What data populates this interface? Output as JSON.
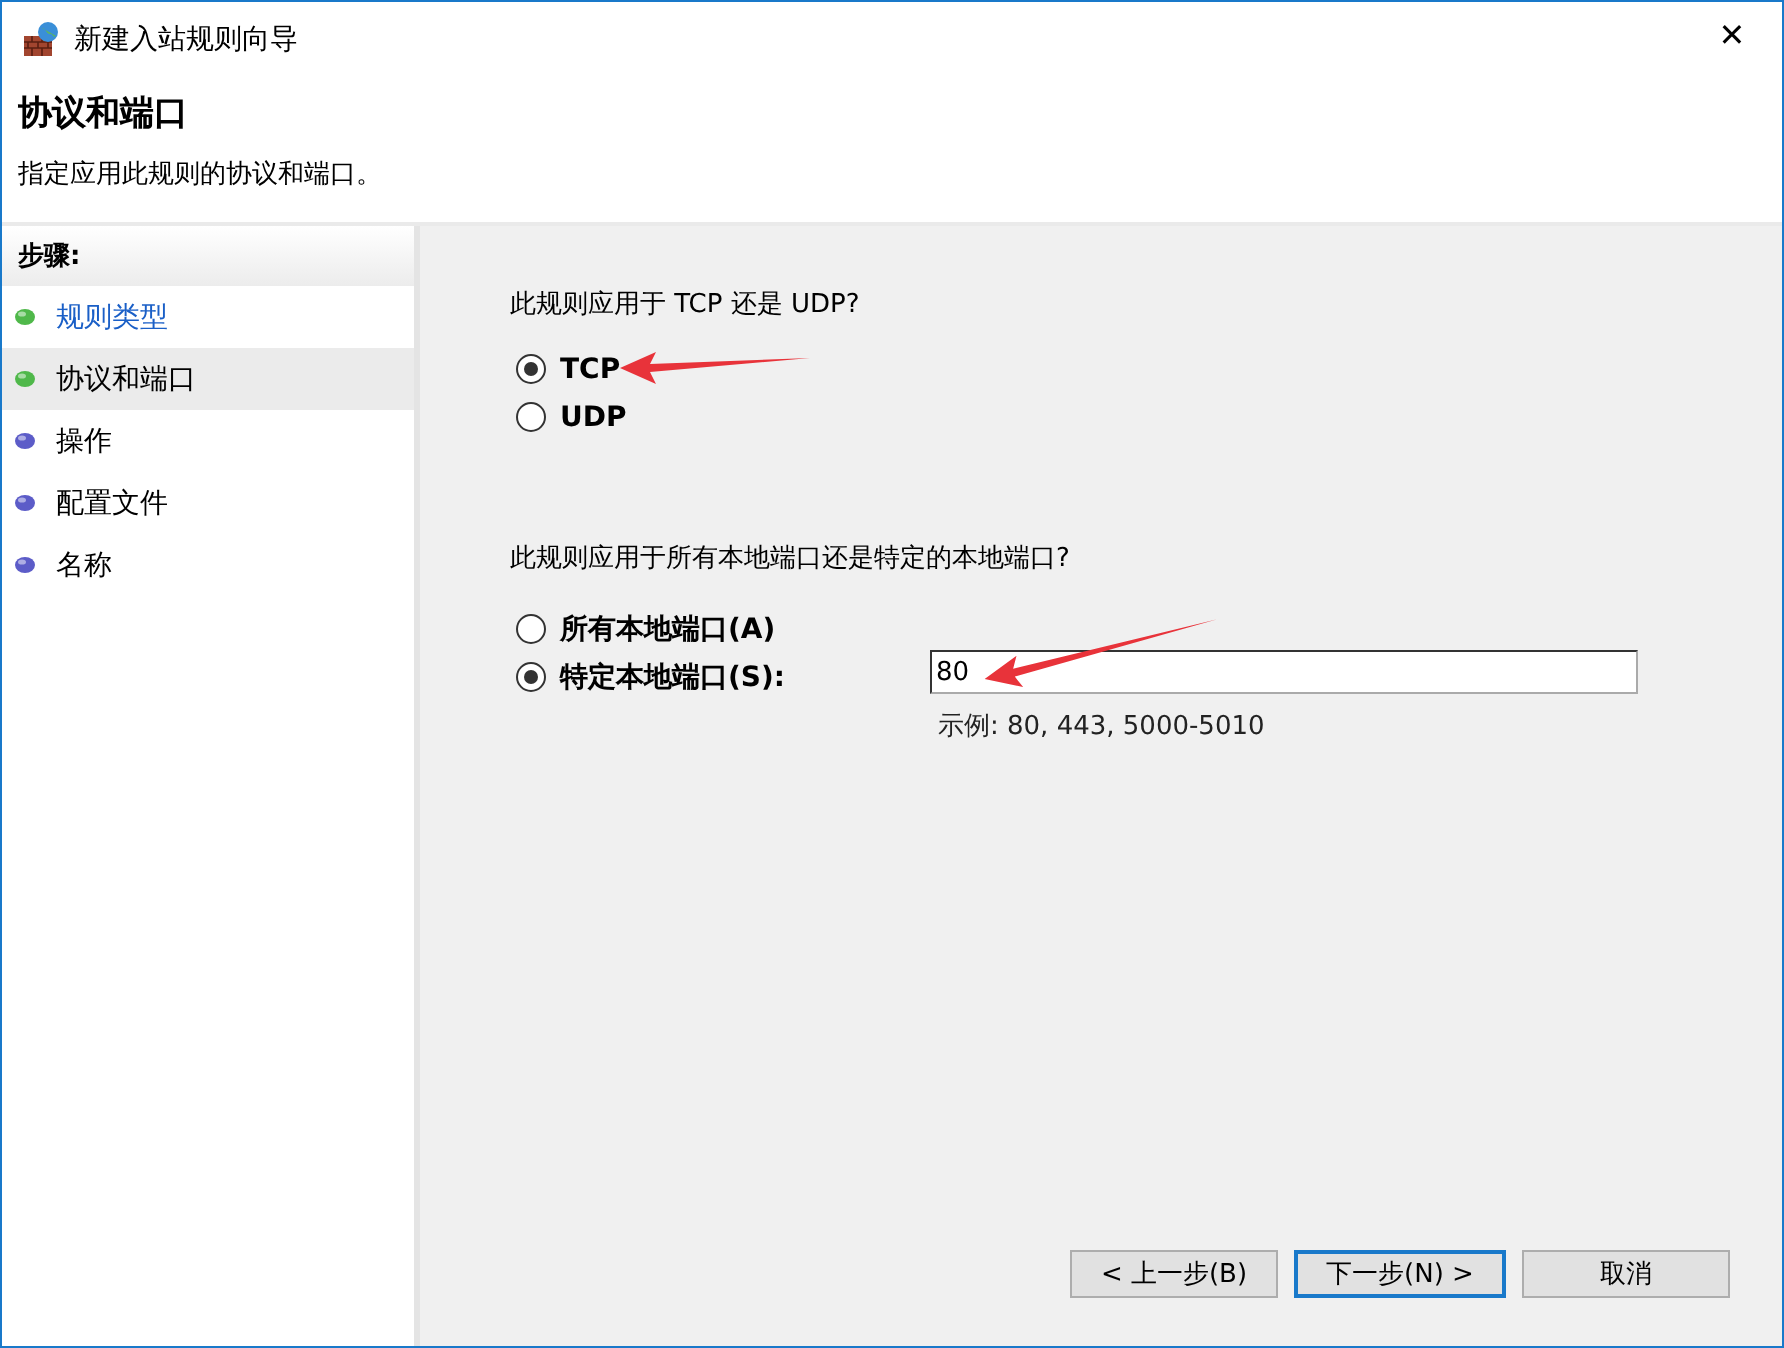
{
  "window": {
    "title": "新建入站规则向导",
    "close": "✕"
  },
  "header": {
    "title": "协议和端口",
    "subtitle": "指定应用此规则的协议和端口。"
  },
  "sidebar": {
    "heading": "步骤:",
    "items": [
      {
        "label": "规则类型",
        "completed": true,
        "selected": false
      },
      {
        "label": "协议和端口",
        "completed": true,
        "selected": true
      },
      {
        "label": "操作",
        "completed": false,
        "selected": false
      },
      {
        "label": "配置文件",
        "completed": false,
        "selected": false
      },
      {
        "label": "名称",
        "completed": false,
        "selected": false
      }
    ]
  },
  "protocol": {
    "question": "此规则应用于 TCP 还是 UDP?",
    "options": [
      {
        "label": "TCP",
        "selected": true,
        "arrow": true
      },
      {
        "label": "UDP",
        "selected": false,
        "arrow": false
      }
    ]
  },
  "ports": {
    "question": "此规则应用于所有本地端口还是特定的本地端口?",
    "options": [
      {
        "label": "所有本地端口(A)",
        "selected": false
      },
      {
        "label": "特定本地端口(S):",
        "selected": true
      }
    ],
    "field": {
      "value": "80",
      "arrow": true
    },
    "hint": "示例: 80, 443, 5000-5010"
  },
  "buttons": [
    {
      "label": "< 上一步(B)",
      "default": false
    },
    {
      "label": "下一步(N) >",
      "default": true
    },
    {
      "label": "取消",
      "default": false
    }
  ]
}
